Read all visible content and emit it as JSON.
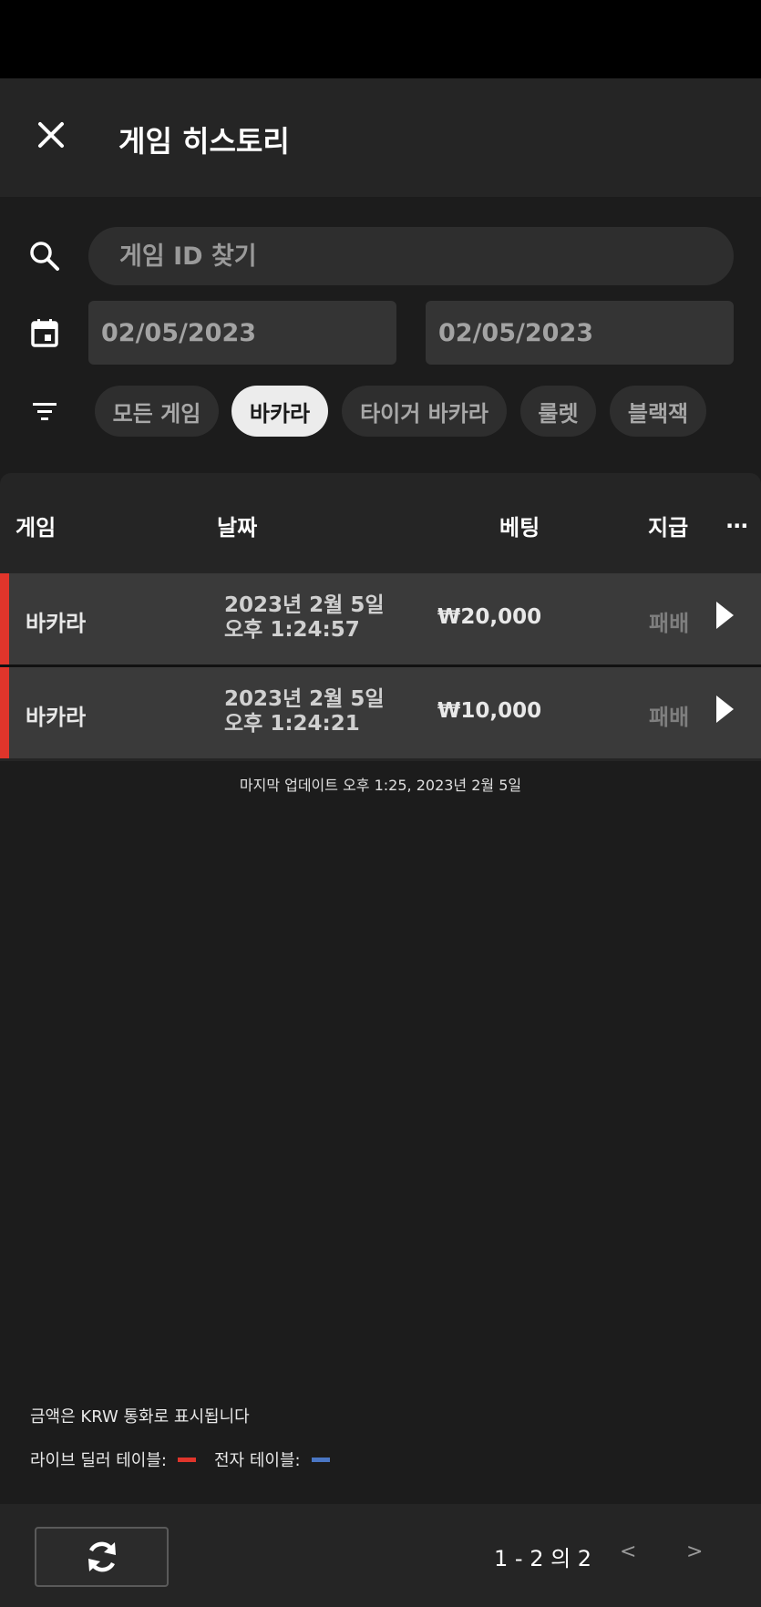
{
  "header": {
    "title": "게임 히스토리",
    "close_icon": "close-icon"
  },
  "filters": {
    "search_placeholder": "게임 ID 찾기",
    "date_from": "02/05/2023",
    "date_to": "02/05/2023",
    "chips": [
      {
        "label": "모든 게임",
        "active": false
      },
      {
        "label": "바카라",
        "active": true
      },
      {
        "label": "타이거 바카라",
        "active": false
      },
      {
        "label": "룰렛",
        "active": false
      },
      {
        "label": "블랙잭",
        "active": false
      }
    ]
  },
  "table": {
    "columns": [
      "게임",
      "날짜",
      "베팅",
      "지급"
    ],
    "more_label": "...",
    "rows": [
      {
        "game": "바카라",
        "date": "2023년 2월 5일",
        "time": "오후 1:24:57",
        "bet": "₩20,000",
        "payout": "패배",
        "table_type": "live"
      },
      {
        "game": "바카라",
        "date": "2023년 2월 5일",
        "time": "오후 1:24:21",
        "bet": "₩10,000",
        "payout": "패배",
        "table_type": "live"
      }
    ]
  },
  "last_update": "마지막 업데이트 오후 1:25, 2023년 2월 5일",
  "notes": {
    "currency": "금액은 KRW 통화로 표시됩니다",
    "legend_live": "라이브 딜러 테이블:",
    "legend_electronic": "전자 테이블:"
  },
  "colors": {
    "live": "#e0352b",
    "electronic": "#4a76c4"
  },
  "pagination": {
    "label": "1 - 2 의 2",
    "prev": "<",
    "next": ">"
  }
}
